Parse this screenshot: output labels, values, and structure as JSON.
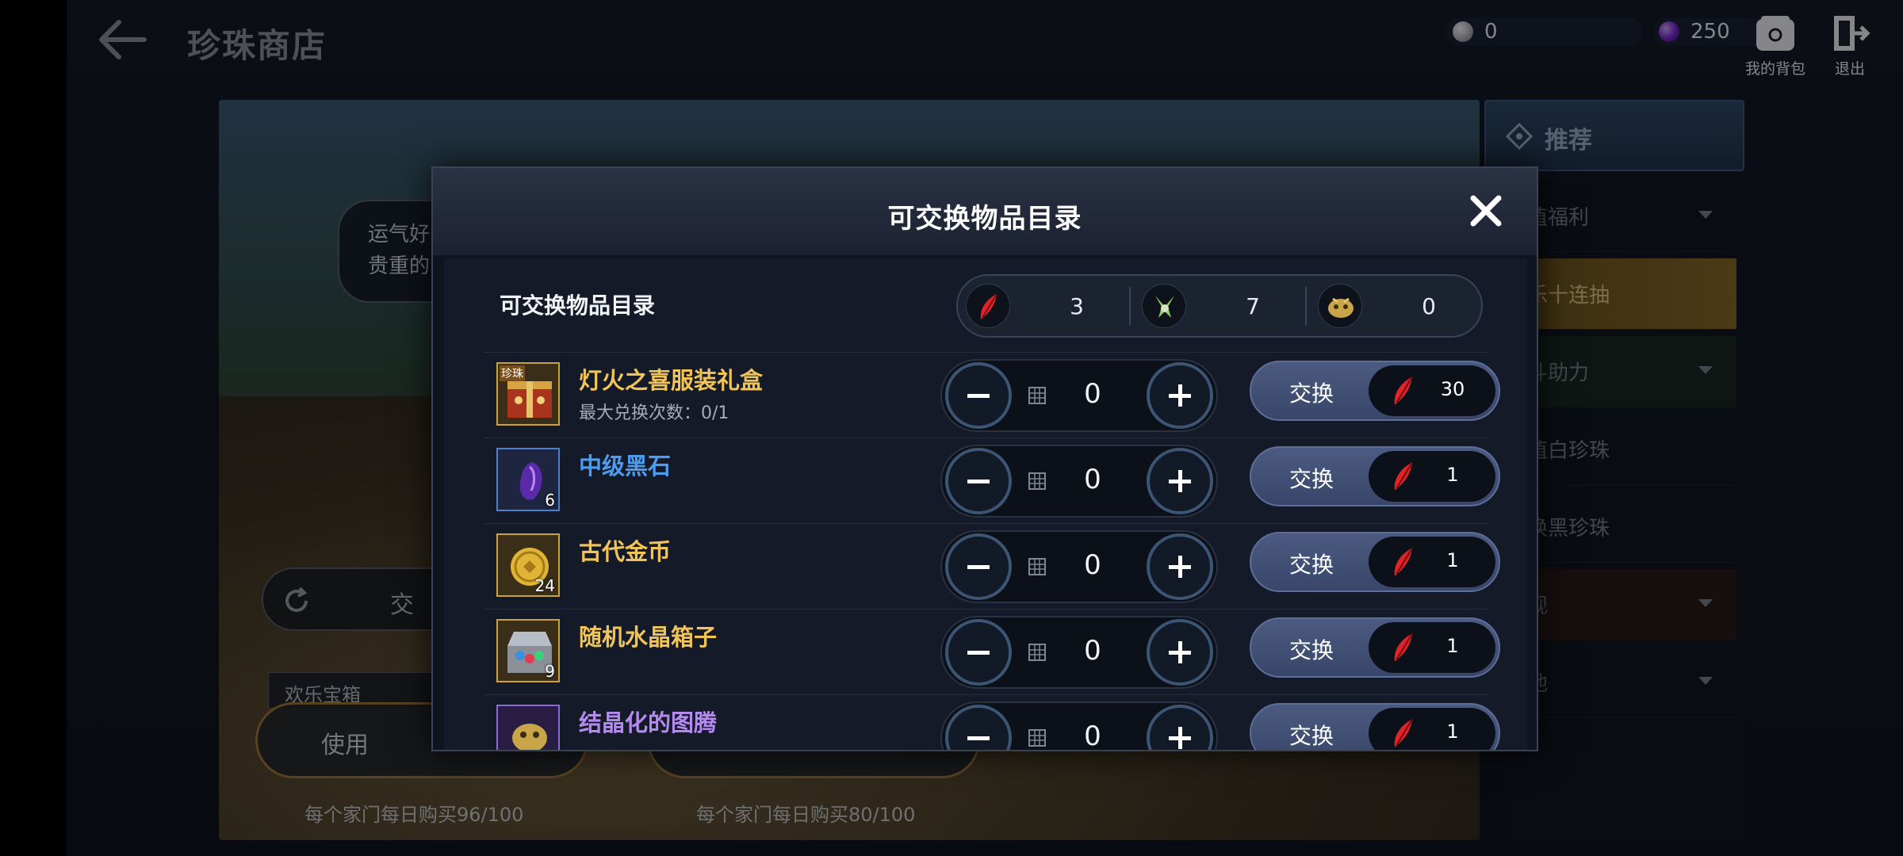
{
  "screen": {
    "title": "珍珠商店",
    "currency": {
      "white_pearl": "0",
      "black_pearl": "250"
    },
    "bag_label": "我的背包",
    "exit_label": "退出"
  },
  "banner": {
    "speech_lines": [
      "运气好的话",
      "贵重的东西"
    ],
    "refresh_text": "交",
    "box_label": "欢乐宝箱",
    "use_label": "使用",
    "daily_limit_1": "每个家门每日购买96/100",
    "daily_limit_2": "每个家门每日购买80/100"
  },
  "sidebar": {
    "header": "推荐",
    "items": [
      {
        "label": "超值福利",
        "dropdown": true
      },
      {
        "label": "欢乐十连抽",
        "dropdown": false
      },
      {
        "label": "战斗助力",
        "dropdown": true
      },
      {
        "label": "充值白珍珠",
        "dropdown": false
      },
      {
        "label": "兑换黑珍珠",
        "dropdown": false
      },
      {
        "label": "外观",
        "dropdown": true
      },
      {
        "label": "其他",
        "dropdown": true
      }
    ]
  },
  "modal": {
    "title": "可交换物品目录",
    "list_title": "可交换物品目录",
    "inventory": [
      {
        "icon": "red-feather-icon",
        "count": "3"
      },
      {
        "icon": "green-token-icon",
        "count": "7"
      },
      {
        "icon": "golden-mask-icon",
        "count": "0"
      }
    ],
    "exchange_label": "交换",
    "items": [
      {
        "name": "灯火之喜服装礼盒",
        "limit": "最大兑换次数：0/1",
        "qty": "",
        "icon_badge": "珍珠",
        "icon": "costume-box-icon",
        "quantity": "0",
        "price": "30"
      },
      {
        "name": "中级黑石",
        "limit": "",
        "qty": "6",
        "icon_badge": "",
        "icon": "black-stone-icon",
        "quantity": "0",
        "price": "1"
      },
      {
        "name": "古代金币",
        "limit": "",
        "qty": "24",
        "icon_badge": "",
        "icon": "gold-coin-icon",
        "quantity": "0",
        "price": "1"
      },
      {
        "name": "随机水晶箱子",
        "limit": "",
        "qty": "9",
        "icon_badge": "",
        "icon": "crystal-chest-icon",
        "quantity": "0",
        "price": "1"
      },
      {
        "name": "结晶化的图腾",
        "limit": "",
        "qty": "",
        "icon_badge": "",
        "icon": "totem-icon",
        "quantity": "0",
        "price": "1"
      }
    ]
  }
}
